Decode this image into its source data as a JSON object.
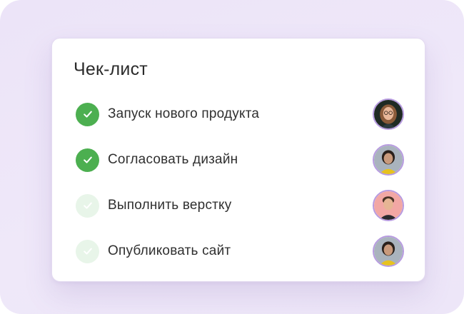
{
  "checklist": {
    "title": "Чек-лист",
    "items": [
      {
        "label": "Запуск нового продукта",
        "status": "done",
        "status_color": "#4caf50",
        "avatar": "avatar-woman-glasses-dark-bg"
      },
      {
        "label": "Согласовать дизайн",
        "status": "done",
        "status_color": "#4caf50",
        "avatar": "avatar-woman-yellow-top"
      },
      {
        "label": "Выполнить верстку",
        "status": "todo",
        "status_color": "#e8f5e9",
        "avatar": "avatar-man-pink-bg"
      },
      {
        "label": "Опубликовать сайт",
        "status": "todo",
        "status_color": "#e8f5e9",
        "avatar": "avatar-woman-yellow-top"
      }
    ]
  },
  "colors": {
    "background": "#ece4f8",
    "card": "#ffffff",
    "check_done": "#4caf50",
    "check_todo": "#e8f5e9",
    "avatar_ring": "#b79be0"
  }
}
